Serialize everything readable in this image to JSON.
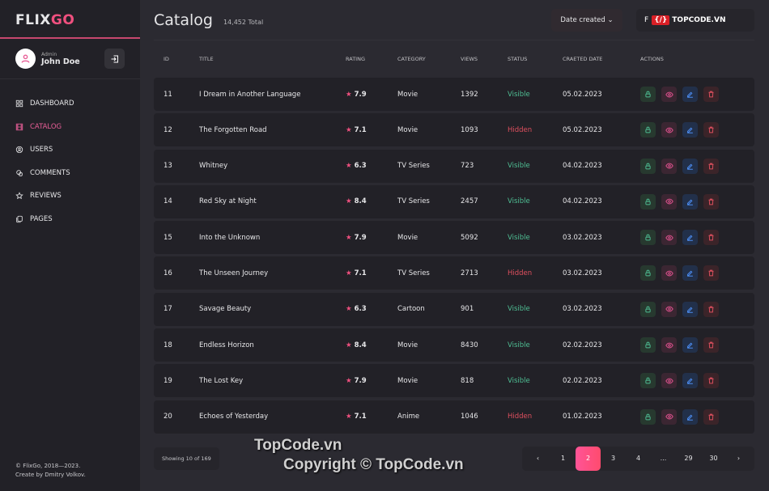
{
  "sidebar": {
    "logo_a": "FLIX",
    "logo_b": "GO",
    "user_role": "Admin",
    "user_name": "John Doe",
    "items": [
      {
        "label": "DASHBOARD",
        "icon": "grid-icon"
      },
      {
        "label": "CATALOG",
        "icon": "film-icon",
        "active": true
      },
      {
        "label": "USERS",
        "icon": "user-circle-icon"
      },
      {
        "label": "COMMENTS",
        "icon": "comments-icon"
      },
      {
        "label": "REVIEWS",
        "icon": "star-icon"
      },
      {
        "label": "PAGES",
        "icon": "pages-icon"
      }
    ],
    "copyright": "© FlixGo, 2018—2023.",
    "credit": "Create by Dmitry Volkov."
  },
  "header": {
    "title": "Catalog",
    "total": "14,452 Total",
    "sort_label": "Date created",
    "filter_label": "F"
  },
  "table": {
    "columns": [
      "ID",
      "TITLE",
      "RATING",
      "CATEGORY",
      "VIEWS",
      "STATUS",
      "CRAETED DATE",
      "ACTIONS"
    ],
    "rows": [
      [
        "11",
        "I Dream in Another Language",
        "7.9",
        "Movie",
        "1392",
        "Visible",
        "05.02.2023"
      ],
      [
        "12",
        "The Forgotten Road",
        "7.1",
        "Movie",
        "1093",
        "Hidden",
        "05.02.2023"
      ],
      [
        "13",
        "Whitney",
        "6.3",
        "TV Series",
        "723",
        "Visible",
        "04.02.2023"
      ],
      [
        "14",
        "Red Sky at Night",
        "8.4",
        "TV Series",
        "2457",
        "Visible",
        "04.02.2023"
      ],
      [
        "15",
        "Into the Unknown",
        "7.9",
        "Movie",
        "5092",
        "Visible",
        "03.02.2023"
      ],
      [
        "16",
        "The Unseen Journey",
        "7.1",
        "TV Series",
        "2713",
        "Hidden",
        "03.02.2023"
      ],
      [
        "17",
        "Savage Beauty",
        "6.3",
        "Cartoon",
        "901",
        "Visible",
        "03.02.2023"
      ],
      [
        "18",
        "Endless Horizon",
        "8.4",
        "Movie",
        "8430",
        "Visible",
        "02.02.2023"
      ],
      [
        "19",
        "The Lost Key",
        "7.9",
        "Movie",
        "818",
        "Visible",
        "02.02.2023"
      ],
      [
        "20",
        "Echoes of Yesterday",
        "7.1",
        "Anime",
        "1046",
        "Hidden",
        "01.02.2023"
      ]
    ]
  },
  "footer": {
    "showing": "Showing 10 of 169",
    "pages": [
      "1",
      "2",
      "3",
      "4",
      "...",
      "29",
      "30"
    ],
    "current": "2"
  },
  "watermark": {
    "logo": "TOPCODE.VN",
    "line1": "TopCode.vn",
    "line2": "Copyright © TopCode.vn"
  },
  "colors": {
    "accent": "#f0507f",
    "visible": "#4fbf94",
    "hidden": "#e0505f"
  }
}
